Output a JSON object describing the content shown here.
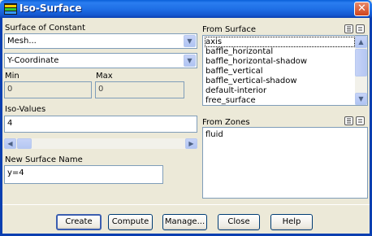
{
  "window": {
    "title": "Iso-Surface",
    "close_glyph": "✕"
  },
  "surface_of_constant": {
    "label": "Surface of Constant",
    "category_value": "Mesh...",
    "quantity_value": "Y-Coordinate"
  },
  "range": {
    "min_label": "Min",
    "min_value": "0",
    "max_label": "Max",
    "max_value": "0"
  },
  "iso_values": {
    "label": "Iso-Values",
    "value": "4"
  },
  "new_surface": {
    "label": "New Surface Name",
    "value": "y=4"
  },
  "from_surface": {
    "label": "From Surface",
    "items": [
      "axis",
      "baffle_horizontal",
      "baffle_horizontal-shadow",
      "baffle_vertical",
      "baffle_vertical-shadow",
      "default-interior",
      "free_surface"
    ]
  },
  "from_zones": {
    "label": "From Zones",
    "items": [
      "fluid"
    ]
  },
  "buttons": {
    "create": "Create",
    "compute": "Compute",
    "manage": "Manage...",
    "close": "Close",
    "help": "Help"
  },
  "icons": {
    "app": "iso-surface-app-icon",
    "select_all": "select-all-icon",
    "deselect_all": "deselect-all-icon",
    "dropdown": "chevron-down-icon"
  },
  "colors": {
    "titlebar": "#1f6fe6",
    "dialog_bg": "#ece9d8",
    "field_border": "#7f9db9",
    "close_button": "#d0441c"
  }
}
